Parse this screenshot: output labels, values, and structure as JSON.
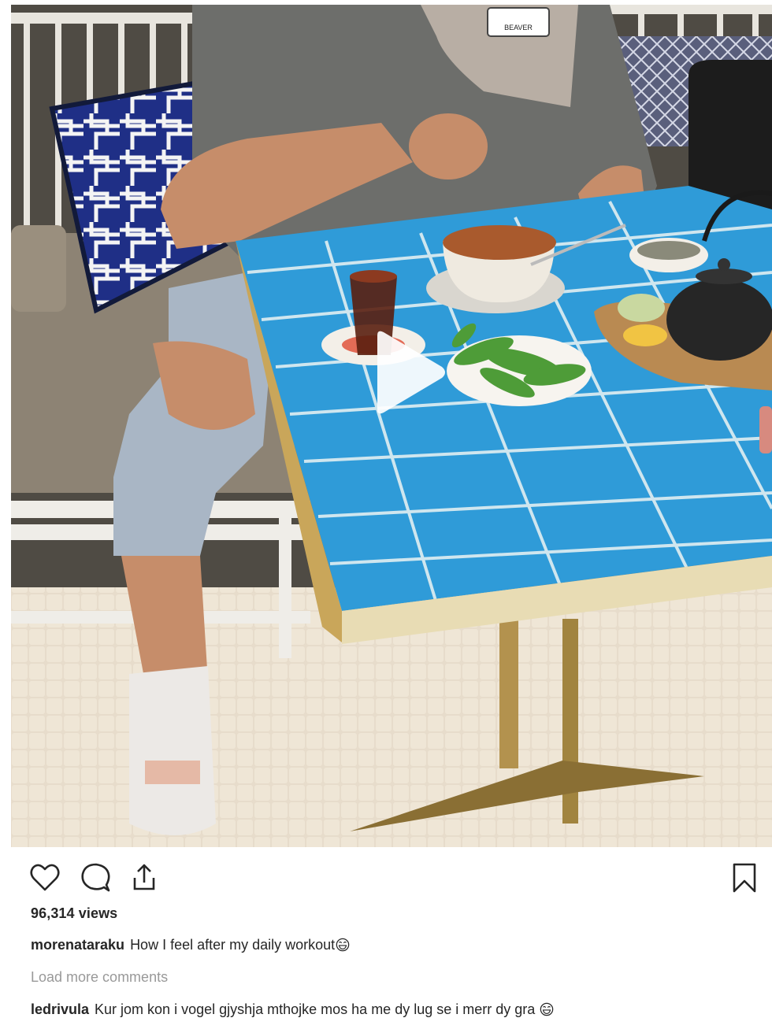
{
  "media": {
    "type": "video",
    "cap_text": "BEAVER",
    "play_icon": "play-icon"
  },
  "actions": {
    "like_icon": "heart-icon",
    "comment_icon": "comment-icon",
    "share_icon": "share-icon",
    "save_icon": "bookmark-icon"
  },
  "stats": {
    "views": "96,314 views"
  },
  "caption": {
    "username": "morenataraku",
    "text": "How I feel after my daily workout",
    "emoji": "laughing-emoji"
  },
  "comments": {
    "load_more": "Load more comments",
    "items": [
      {
        "username": "ledrivula",
        "text": "Kur jom kon i vogel gjyshja mthojke mos ha me dy lug se i merr dy gra",
        "emoji": "laughing-emoji"
      }
    ]
  },
  "colors": {
    "tile_blue": "#2f9bd8",
    "tile_grout": "#cfe6ef",
    "table_rim": "#c9a65a",
    "text_primary": "#262626",
    "text_muted": "#999999"
  }
}
